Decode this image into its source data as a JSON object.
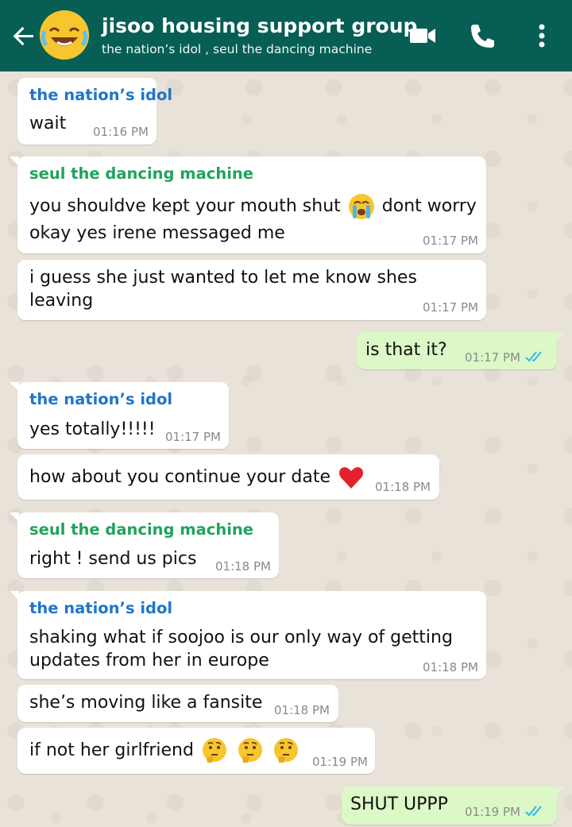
{
  "header": {
    "title": "jisoo housing support group",
    "subtitle": "the nation’s idol , seul the dancing machine",
    "icons": [
      "back-arrow-icon",
      "video-call-icon",
      "phone-icon",
      "more-options-icon"
    ]
  },
  "colors": {
    "header_bg": "#075E54",
    "incoming_bubble": "#FFFFFF",
    "outgoing_bubble": "#DCF8C6",
    "sender_nations_idol": "#1F76C9",
    "sender_seul": "#1FA35B",
    "read_ticks": "#34B7F1"
  },
  "messages": [
    {
      "sender": "the nation’s idol",
      "text": "wait",
      "time": "01:16 PM"
    },
    {
      "sender": "seul the dancing machine",
      "line1a": "you shouldve kept your mouth shut",
      "emoji1": "loudly-crying-face-emoji",
      "line1b": "dont worry",
      "line2": "okay yes irene messaged me",
      "time": "01:17 PM"
    },
    {
      "line1": "i guess she just wanted to let me know shes",
      "line2": "leaving",
      "time": "01:17 PM"
    },
    {
      "text": "is that it?",
      "time": "01:17 PM",
      "outgoing": true
    },
    {
      "sender": "the nation’s idol",
      "text": "yes totally!!!!!",
      "time": "01:17 PM"
    },
    {
      "text": "how about you continue your date",
      "emoji": "red-heart-emoji",
      "time": "01:18 PM"
    },
    {
      "sender": "seul the dancing machine",
      "text": "right ! send us pics",
      "time": "01:18 PM"
    },
    {
      "sender": "the nation’s idol",
      "line1": "shaking what if soojoo is our only way of getting",
      "line2": "updates from her in europe",
      "time": "01:18 PM"
    },
    {
      "text": "she’s moving like a fansite",
      "time": "01:18 PM"
    },
    {
      "text": "if not her girlfriend",
      "emoji": "thinking-face-emoji",
      "emoji_count": 3,
      "time": "01:19 PM"
    },
    {
      "text": "SHUT UPPP",
      "time": "01:19 PM",
      "outgoing": true
    }
  ]
}
